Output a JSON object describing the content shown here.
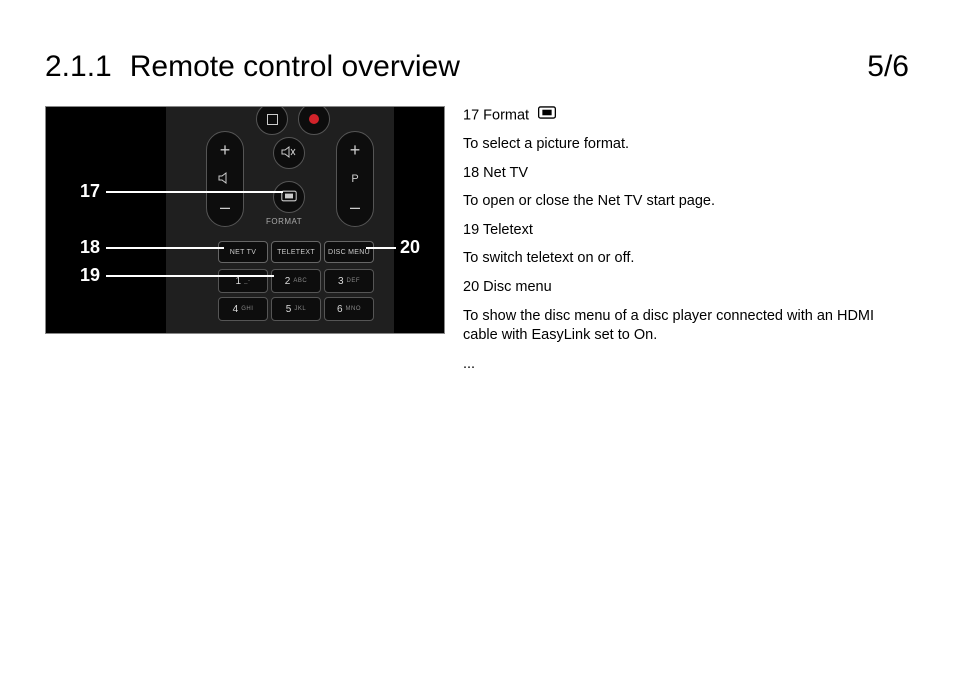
{
  "header": {
    "section_number": "2.1.1",
    "section_title": "Remote control overview",
    "page_indicator": "5/6"
  },
  "callouts": {
    "c17": "17",
    "c18": "18",
    "c19": "19",
    "c20": "20"
  },
  "remote": {
    "volume": {
      "plus": "+",
      "minus": "–",
      "icon": "volume-icon"
    },
    "program": {
      "plus": "+",
      "minus": "–",
      "label": "P"
    },
    "stop": {
      "icon": "stop-icon"
    },
    "record": {
      "icon": "record-icon"
    },
    "mute": {
      "icon": "mute-icon"
    },
    "format": {
      "icon": "format-icon",
      "label": "FORMAT"
    },
    "row_buttons": {
      "net_tv": "NET TV",
      "teletext": "TELETEXT",
      "disc_menu": "DISC MENU"
    },
    "numpad": {
      "b1": {
        "n": "1",
        "sub": "_-"
      },
      "b2": {
        "n": "2",
        "sub": "ABC"
      },
      "b3": {
        "n": "3",
        "sub": "DEF"
      },
      "b4": {
        "n": "4",
        "sub": "GHI"
      },
      "b5": {
        "n": "5",
        "sub": "JKL"
      },
      "b6": {
        "n": "6",
        "sub": "MNO"
      }
    }
  },
  "descriptions": {
    "d17_title": "17 Format",
    "d17_body": "To select a picture format.",
    "d18_title": "18 Net TV",
    "d18_body": "To open or close the Net TV start page.",
    "d19_title": "19 Teletext",
    "d19_body": "To switch teletext on or off.",
    "d20_title": "20 Disc menu",
    "d20_body": "To show the disc menu of a disc player connected with an HDMI cable with EasyLink set to On.",
    "continuation": "..."
  }
}
